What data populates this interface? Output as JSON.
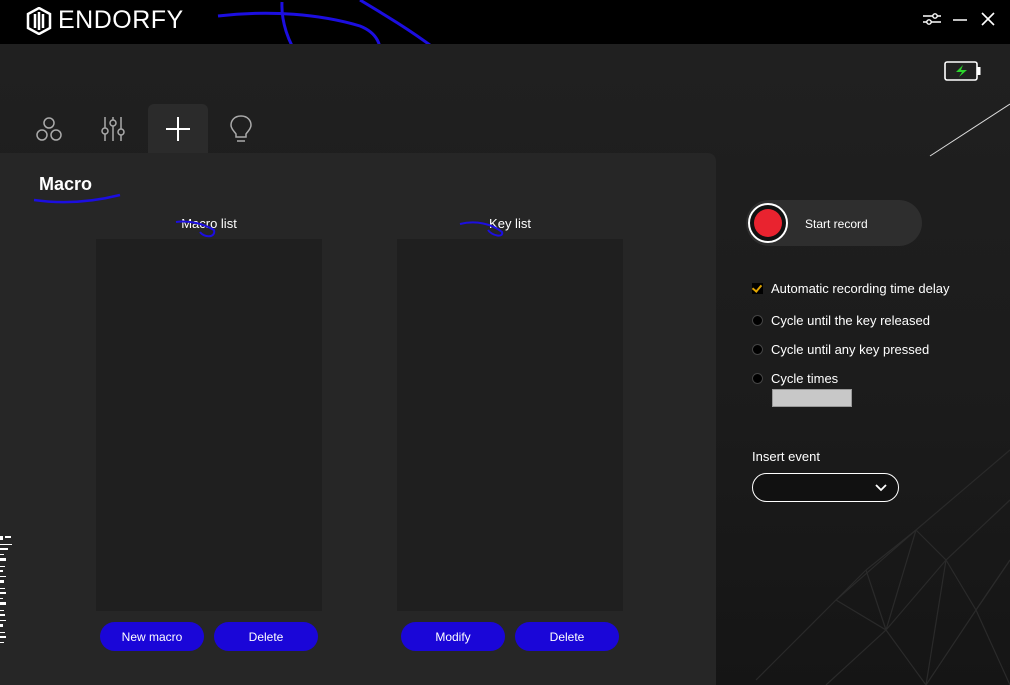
{
  "app": {
    "brand": "ENDORFY"
  },
  "tabs": [
    {
      "id": "profiles",
      "icon": "circles-icon"
    },
    {
      "id": "settings",
      "icon": "sliders-icon"
    },
    {
      "id": "macro",
      "icon": "plus-icon",
      "active": true
    },
    {
      "id": "lighting",
      "icon": "bulb-icon"
    }
  ],
  "section": {
    "title": "Macro"
  },
  "macro_list": {
    "title": "Macro list",
    "new_label": "New macro",
    "delete_label": "Delete"
  },
  "key_list": {
    "title": "Key list",
    "modify_label": "Modify",
    "delete_label": "Delete"
  },
  "record": {
    "label": "Start record"
  },
  "options": {
    "auto_delay": "Automatic recording time delay",
    "cycle_release": "Cycle until the key released",
    "cycle_any": "Cycle until any key pressed",
    "cycle_times": "Cycle times"
  },
  "insert_event": {
    "label": "Insert event",
    "value": ""
  },
  "colors": {
    "accent": "#1a06d8",
    "record": "#e9232f",
    "check": "#e0a400",
    "battery": "#2bd42b"
  }
}
